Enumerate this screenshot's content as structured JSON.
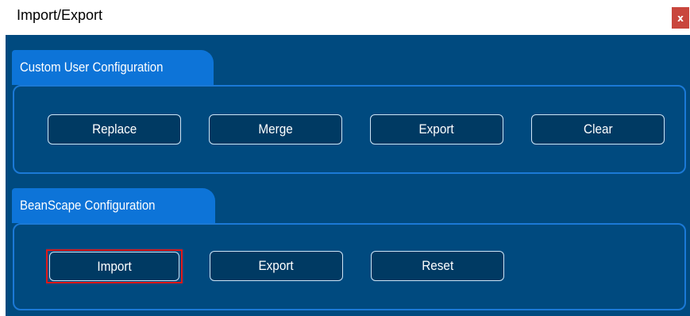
{
  "window": {
    "title": "Import/Export",
    "close_label": "x"
  },
  "custom_user_configuration": {
    "label": "Custom User Configuration",
    "buttons": {
      "replace": "Replace",
      "merge": "Merge",
      "export": "Export",
      "clear": "Clear"
    }
  },
  "beanscape_configuration": {
    "label": "BeanScape Configuration",
    "buttons": {
      "import": "Import",
      "export": "Export",
      "reset": "Reset"
    },
    "focused_button": "Import"
  },
  "colors": {
    "panel_background": "#004a7f",
    "tab_background": "#0d74d8",
    "border": "#1b79d6",
    "close_button": "#c9463d",
    "focus_outline": "#e01818"
  }
}
